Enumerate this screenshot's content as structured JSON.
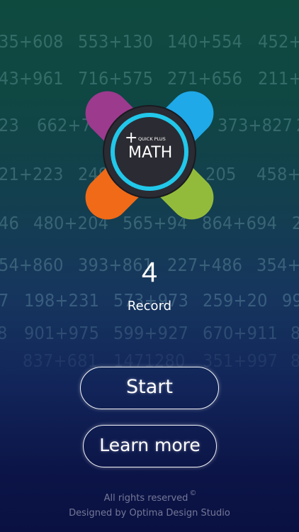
{
  "background_equations": [
    [
      "35+608",
      "553+130",
      "140+554",
      "452+"
    ],
    [
      "43+961",
      "716+575",
      "271+656",
      "211+"
    ],
    [
      "23",
      "662+70",
      "373+827",
      "2"
    ],
    [
      "21+223",
      "249",
      "205",
      "458+"
    ],
    [
      "46",
      "480+204",
      "565+94",
      "864+694",
      "2"
    ],
    [
      "54+860",
      "393+861",
      "227+486",
      "354+"
    ],
    [
      "7",
      "198+231",
      "573+973",
      "259+20",
      "99"
    ],
    [
      "8",
      "901+975",
      "599+927",
      "670+911",
      "8"
    ],
    [
      "837+681",
      "1471280",
      "351+997",
      "8"
    ]
  ],
  "logo": {
    "small_text": "QUICK PLUS",
    "plus_sign": "+",
    "title": "MATH",
    "colors": {
      "blue": "#1fa9e8",
      "purple": "#9c3a8d",
      "orange": "#f06a17",
      "green": "#93bb3b",
      "ring": "#21c8ea",
      "center": "#2b2b33"
    }
  },
  "record": {
    "value": "4",
    "label": "Record"
  },
  "buttons": {
    "start": "Start",
    "learn_more": "Learn more"
  },
  "footer": {
    "rights": "All rights reserved",
    "copyright_symbol": "©",
    "credit": "Designed by Optima Design Studio"
  }
}
